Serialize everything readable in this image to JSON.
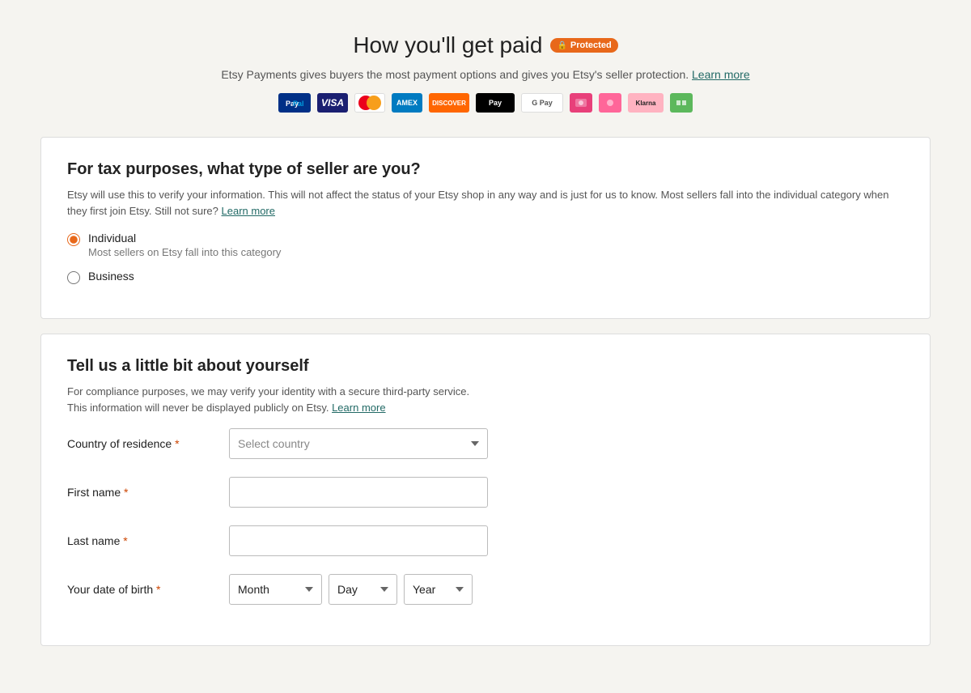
{
  "header": {
    "title": "How you'll get paid",
    "protected_label": "Protected",
    "description": "Etsy Payments gives buyers the most payment options and gives you Etsy's seller protection.",
    "learn_more": "Learn more"
  },
  "payment_methods": [
    {
      "id": "paypal",
      "label": "PayPal"
    },
    {
      "id": "visa",
      "label": "VISA"
    },
    {
      "id": "mastercard",
      "label": "MC"
    },
    {
      "id": "amex",
      "label": "AMEX"
    },
    {
      "id": "discover",
      "label": "DISCOVER"
    },
    {
      "id": "applepay",
      "label": "Apple Pay"
    },
    {
      "id": "googlepay",
      "label": "Google Pay"
    },
    {
      "id": "icon1",
      "label": ""
    },
    {
      "id": "icon2",
      "label": ""
    },
    {
      "id": "klarna",
      "label": "Klarna"
    },
    {
      "id": "icon3",
      "label": ""
    }
  ],
  "seller_type_section": {
    "title": "For tax purposes, what type of seller are you?",
    "description": "Etsy will use this to verify your information. This will not affect the status of your Etsy shop in any way and is just for us to know. Most sellers fall into the individual category when they first join Etsy. Still not sure?",
    "learn_more": "Learn more",
    "options": [
      {
        "value": "individual",
        "label": "Individual",
        "sublabel": "Most sellers on Etsy fall into this category",
        "checked": true
      },
      {
        "value": "business",
        "label": "Business",
        "sublabel": "",
        "checked": false
      }
    ]
  },
  "about_section": {
    "title": "Tell us a little bit about yourself",
    "description": "For compliance purposes, we may verify your identity with a secure third-party service.\nThis information will never be displayed publicly on Etsy.",
    "learn_more": "Learn more",
    "fields": {
      "country_of_residence": {
        "label": "Country of residence",
        "placeholder": "Select country",
        "required": true
      },
      "first_name": {
        "label": "First name",
        "placeholder": "",
        "required": true
      },
      "last_name": {
        "label": "Last name",
        "placeholder": "",
        "required": true
      },
      "date_of_birth": {
        "label": "Your date of birth",
        "required": true,
        "month_placeholder": "Month",
        "day_placeholder": "Day",
        "year_placeholder": "Year"
      }
    }
  }
}
